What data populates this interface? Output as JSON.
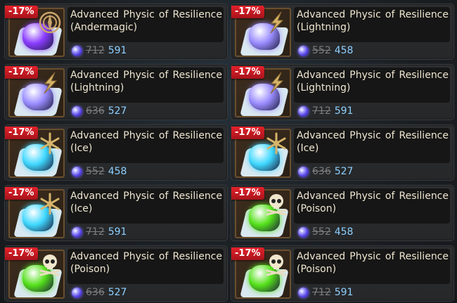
{
  "items": [
    {
      "discount": "-17%",
      "title": "Advanced Physic of Resilience (Andermagic)",
      "old_price": "712",
      "new_price": "591",
      "element": "andermagic-icon",
      "gem_color": "#8a3cff"
    },
    {
      "discount": "-17%",
      "title": "Advanced Physic of Resilience (Lightning)",
      "old_price": "552",
      "new_price": "458",
      "element": "lightning-icon",
      "gem_color": "#9a8cff"
    },
    {
      "discount": "-17%",
      "title": "Advanced Physic of Resilience (Lightning)",
      "old_price": "636",
      "new_price": "527",
      "element": "lightning-icon",
      "gem_color": "#9a8cff"
    },
    {
      "discount": "-17%",
      "title": "Advanced Physic of Resilience (Lightning)",
      "old_price": "712",
      "new_price": "591",
      "element": "lightning-icon",
      "gem_color": "#9a8cff"
    },
    {
      "discount": "-17%",
      "title": "Advanced Physic of Resilience (Ice)",
      "old_price": "552",
      "new_price": "458",
      "element": "snowflake-icon",
      "gem_color": "#3fd8ff"
    },
    {
      "discount": "-17%",
      "title": "Advanced Physic of Resilience (Ice)",
      "old_price": "636",
      "new_price": "527",
      "element": "snowflake-icon",
      "gem_color": "#3fd8ff"
    },
    {
      "discount": "-17%",
      "title": "Advanced Physic of Resilience (Ice)",
      "old_price": "712",
      "new_price": "591",
      "element": "snowflake-icon",
      "gem_color": "#3fd8ff"
    },
    {
      "discount": "-17%",
      "title": "Advanced Physic of Resilience (Poison)",
      "old_price": "552",
      "new_price": "458",
      "element": "skull-icon",
      "gem_color": "#54e11a"
    },
    {
      "discount": "-17%",
      "title": "Advanced Physic of Resilience (Poison)",
      "old_price": "636",
      "new_price": "527",
      "element": "skull-icon",
      "gem_color": "#54e11a"
    },
    {
      "discount": "-17%",
      "title": "Advanced Physic of Resilience (Poison)",
      "old_price": "712",
      "new_price": "591",
      "element": "skull-icon",
      "gem_color": "#54e11a"
    }
  ],
  "colors": {
    "badge": "#d8202a",
    "new_price": "#8fd0ff",
    "old_price": "#7d7d7d",
    "title": "#efe6d0"
  }
}
